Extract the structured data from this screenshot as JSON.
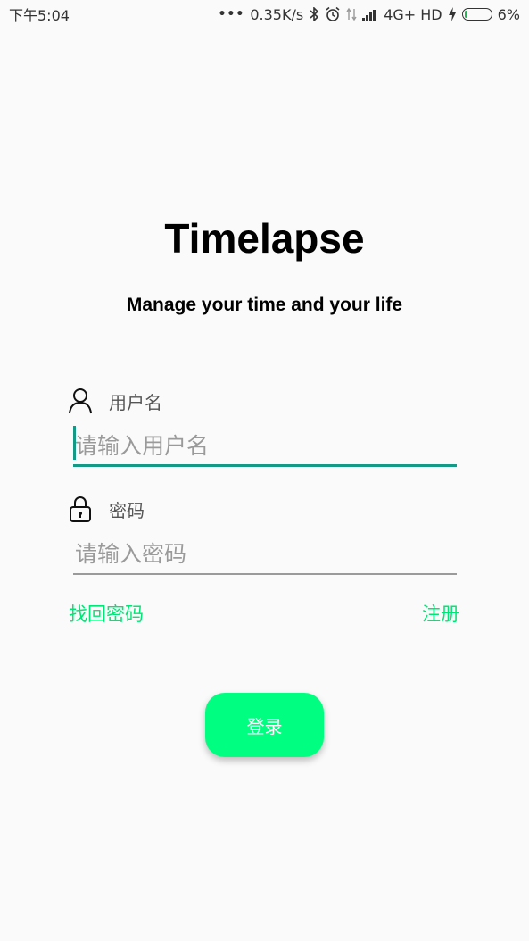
{
  "status_bar": {
    "time": "下午5:04",
    "network_speed": "0.35K/s",
    "network_type": "4G+ HD",
    "battery_percent": "6%",
    "battery_level": 0.06,
    "icons": [
      "more-dots-icon",
      "bluetooth-icon",
      "alarm-icon",
      "data-arrows-icon",
      "signal-icon",
      "charging-icon",
      "battery-icon"
    ]
  },
  "app": {
    "title": "Timelapse",
    "subtitle": "Manage your time and your life"
  },
  "username": {
    "label": "用户名",
    "placeholder": "请输入用户名",
    "value": "",
    "icon": "user-icon"
  },
  "password": {
    "label": "密码",
    "placeholder": "请输入密码",
    "value": "",
    "icon": "lock-icon"
  },
  "links": {
    "forgot_password": "找回密码",
    "register": "注册"
  },
  "login_button": {
    "label": "登录"
  },
  "colors": {
    "accent_green": "#00e676",
    "button_green": "#00ff80",
    "input_focus": "#129a86",
    "background": "#fafafa"
  }
}
